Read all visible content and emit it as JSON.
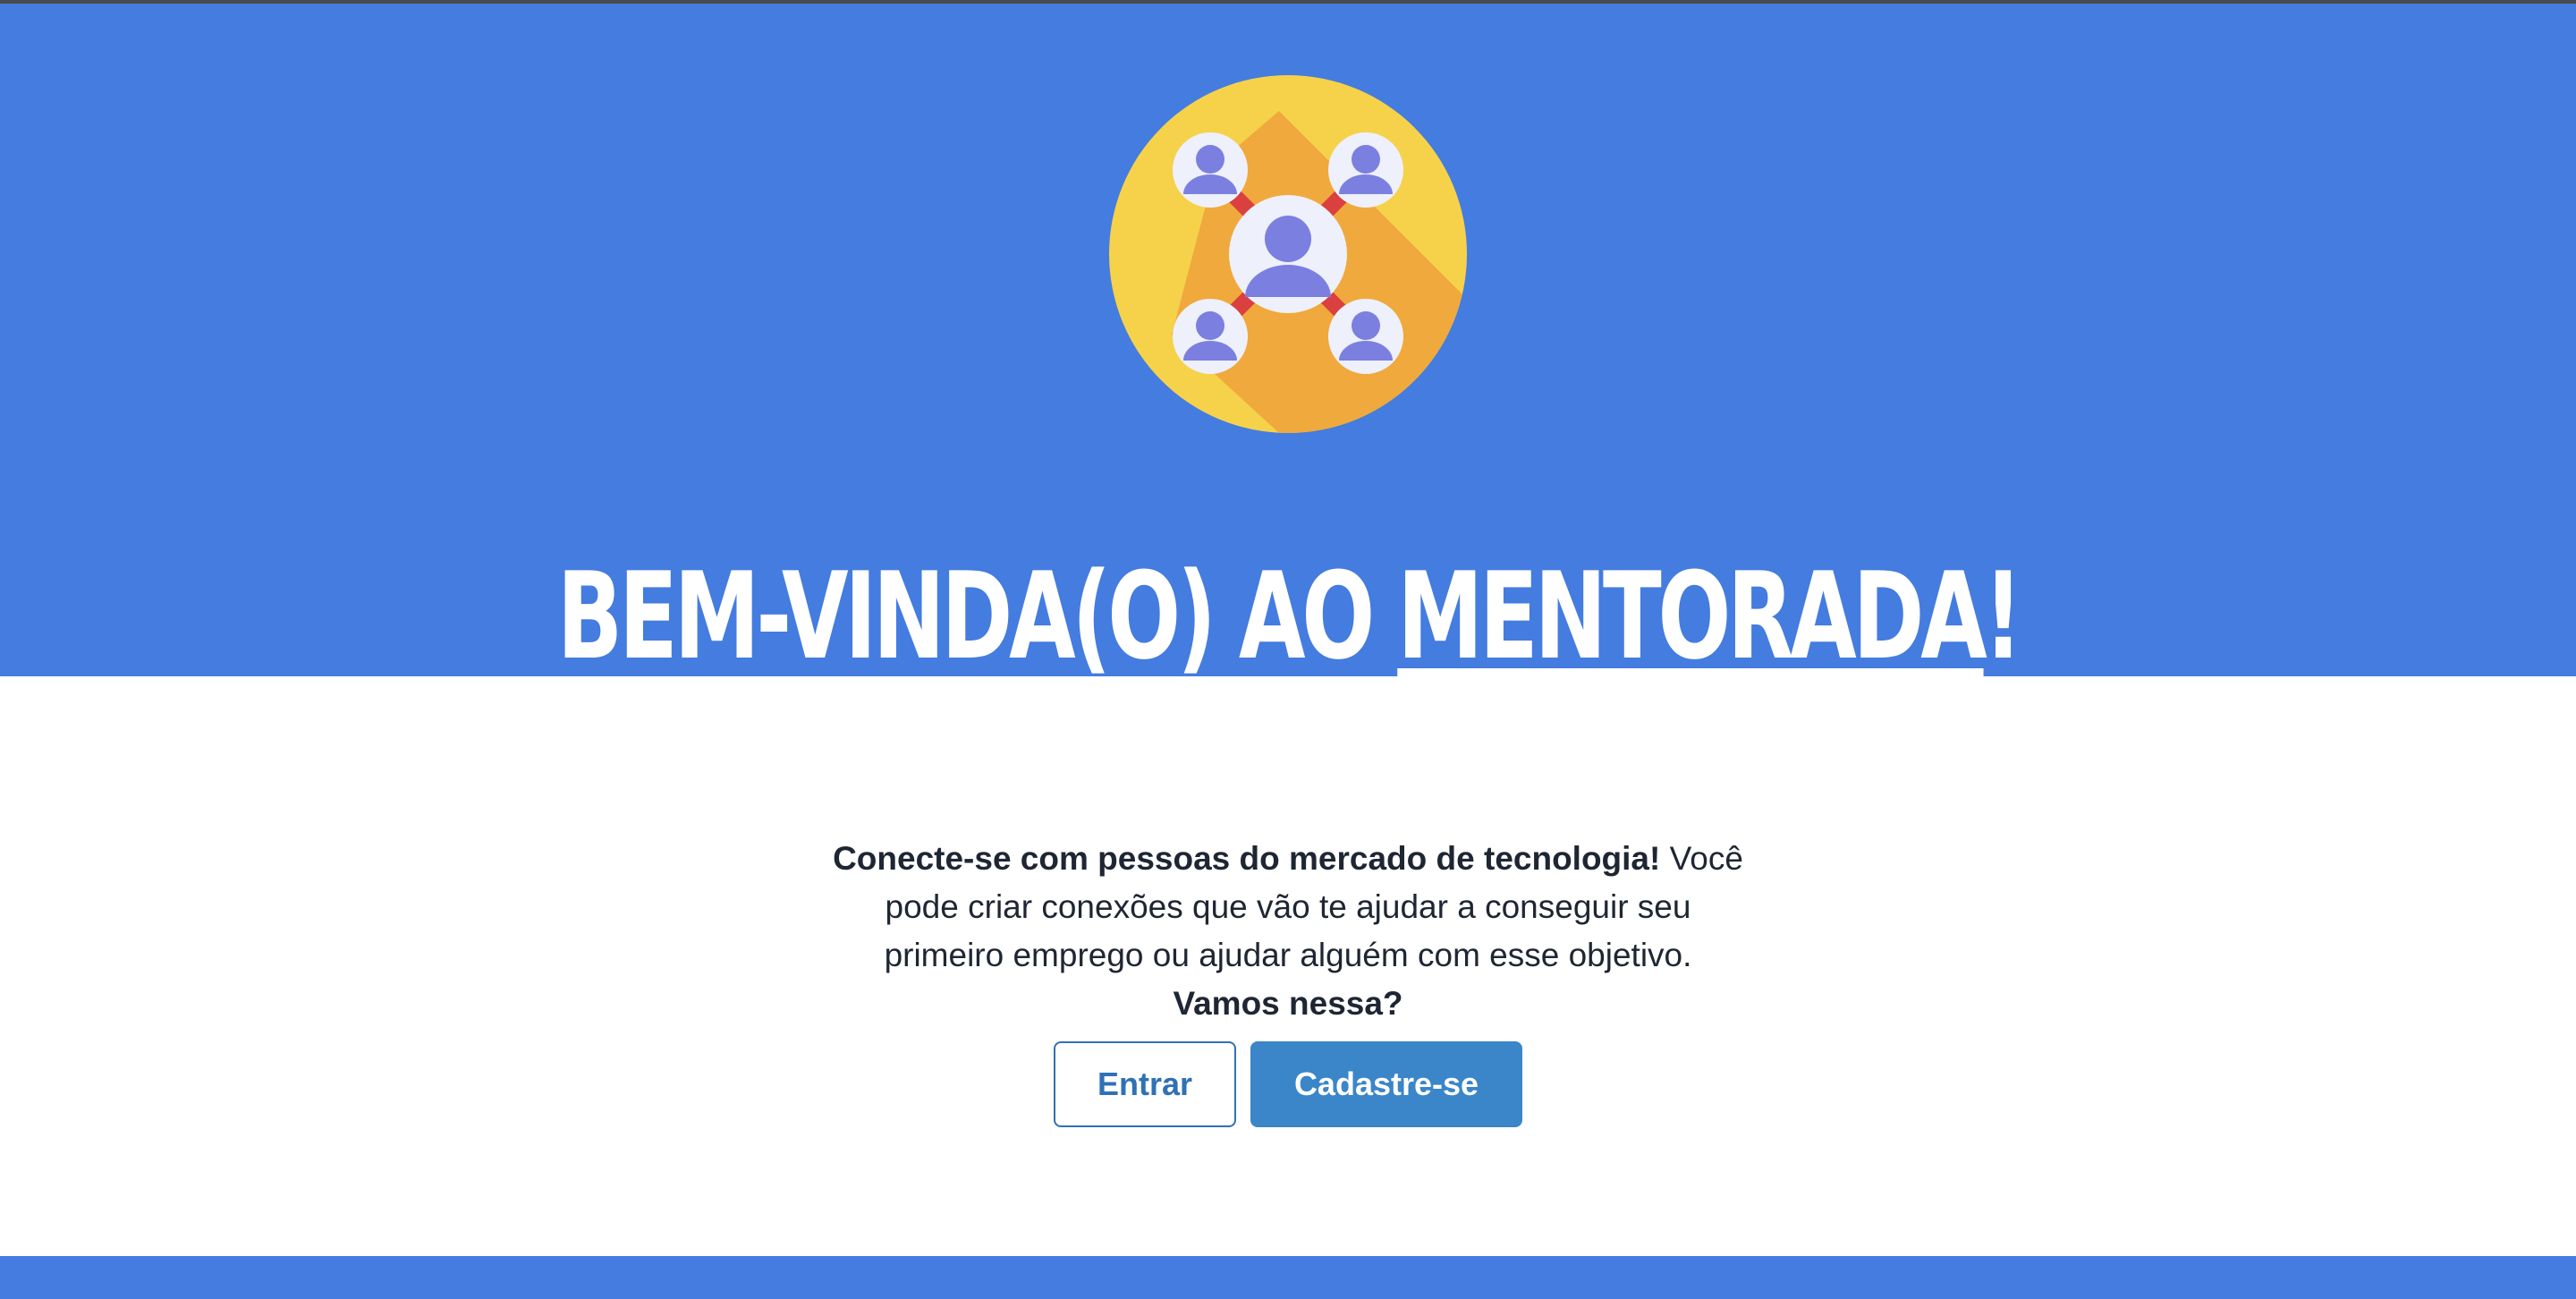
{
  "hero": {
    "title_prefix": "BEM-VINDA(O) AO ",
    "title_brand": "MENTORADA",
    "title_suffix": "!",
    "logo_icon": "network-people-icon",
    "background_color": "#447ce0"
  },
  "intro": {
    "bold_lead": "Conecte-se com pessoas do mercado de tecnologia!",
    "body": " Você pode criar conexões que vão te ajudar a conseguir seu primeiro emprego ou ajudar alguém com esse objetivo.",
    "bold_closing": "Vamos nessa?"
  },
  "actions": {
    "login_label": "Entrar",
    "signup_label": "Cadastre-se",
    "accent_color": "#3a86c8"
  }
}
